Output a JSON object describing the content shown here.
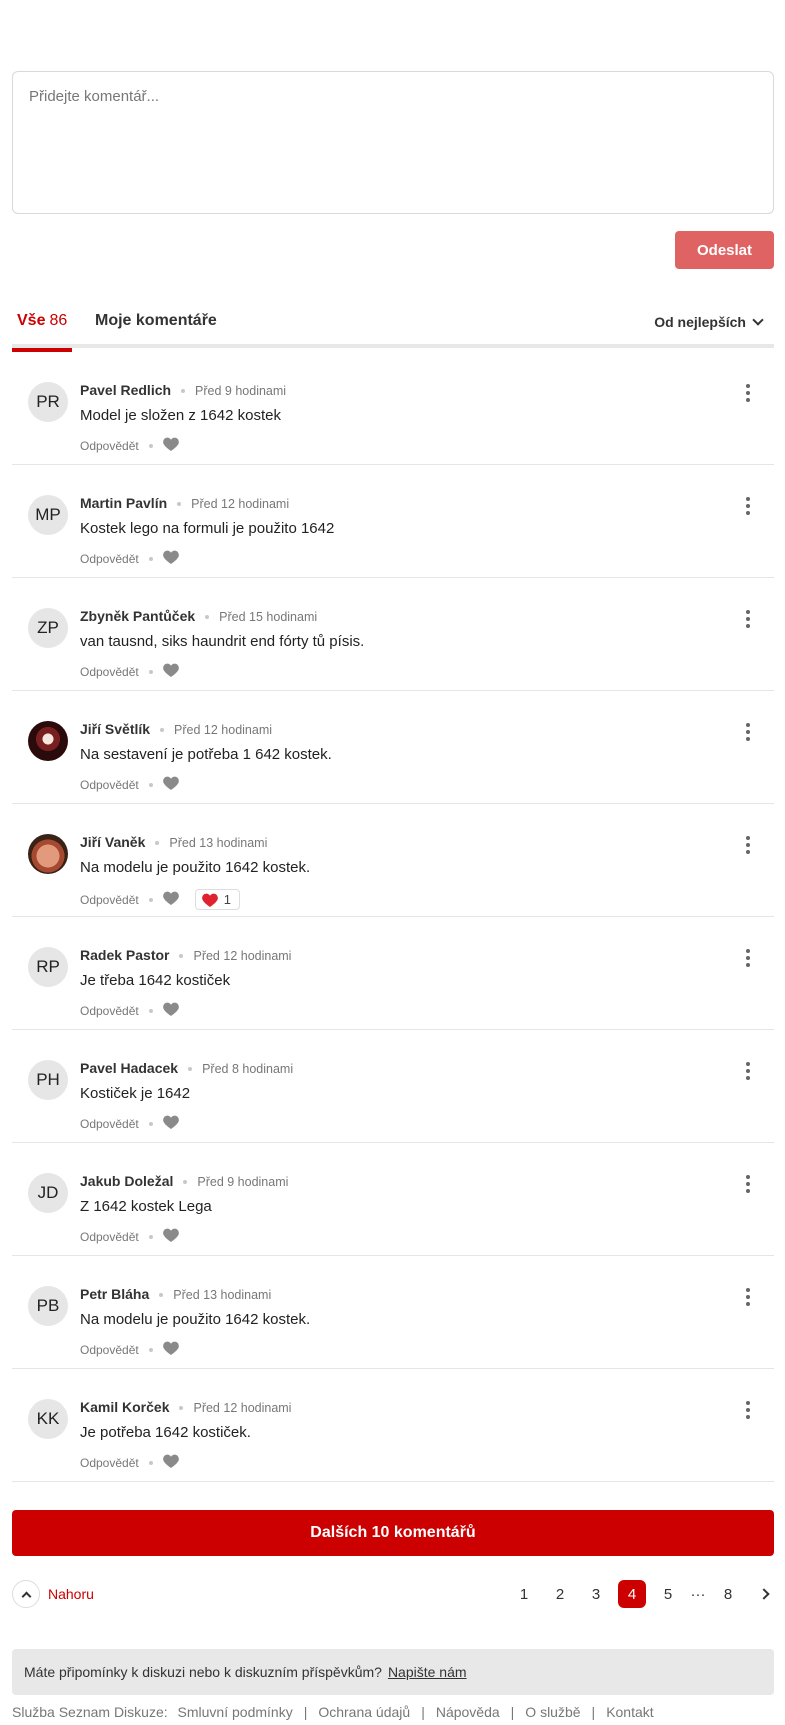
{
  "composer": {
    "placeholder": "Přidejte komentář...",
    "send_label": "Odeslat"
  },
  "tabs": {
    "all_label": "Vše",
    "all_count": "86",
    "mine_label": "Moje komentáře",
    "sort_label": "Od nejlepších"
  },
  "comments": [
    {
      "initials": "PR",
      "author": "Pavel Redlich",
      "time": "Před 9 hodinami",
      "text": "Model je složen z 1642 kostek",
      "reply": "Odpovědět"
    },
    {
      "initials": "MP",
      "author": "Martin Pavlín",
      "time": "Před 12 hodinami",
      "text": "Kostek lego na formuli je použito 1642",
      "reply": "Odpovědět"
    },
    {
      "initials": "ZP",
      "author": "Zbyněk Pantůček",
      "time": "Před 15 hodinami",
      "text": "van tausnd, siks haundrit end fórty tů písis.",
      "reply": "Odpovědět"
    },
    {
      "initials": "",
      "author": "Jiří Světlík",
      "time": "Před 12 hodinami",
      "text": "Na sestavení je potřeba 1 642 kostek.",
      "reply": "Odpovědět"
    },
    {
      "initials": "",
      "author": "Jiří Vaněk",
      "time": "Před 13 hodinami",
      "text": "Na modelu je použito 1642 kostek.",
      "reply": "Odpovědět",
      "likes": "1"
    },
    {
      "initials": "RP",
      "author": "Radek Pastor",
      "time": "Před 12 hodinami",
      "text": "Je třeba 1642 kostiček",
      "reply": "Odpovědět"
    },
    {
      "initials": "PH",
      "author": "Pavel Hadacek",
      "time": "Před 8 hodinami",
      "text": "Kostiček je 1642",
      "reply": "Odpovědět"
    },
    {
      "initials": "JD",
      "author": "Jakub Doležal",
      "time": "Před 9 hodinami",
      "text": "Z 1642 kostek Lega",
      "reply": "Odpovědět"
    },
    {
      "initials": "PB",
      "author": "Petr Bláha",
      "time": "Před 13 hodinami",
      "text": "Na modelu je použito 1642 kostek.",
      "reply": "Odpovědět"
    },
    {
      "initials": "KK",
      "author": "Kamil Korček",
      "time": "Před 12 hodinami",
      "text": "Je potřeba 1642 kostiček.",
      "reply": "Odpovědět"
    }
  ],
  "more_button": "Dalších 10 komentářů",
  "pager": {
    "up_label": "Nahoru",
    "pages": [
      "1",
      "2",
      "3",
      "4",
      "5"
    ],
    "active": "4",
    "ellipsis": "···",
    "last": "8"
  },
  "feedback": {
    "text": "Máte připomínky k diskuzi nebo k diskuzním příspěvkům?",
    "link": "Napište nám"
  },
  "footer": {
    "service": "Služba Seznam Diskuze:",
    "links": [
      "Smluvní podmínky",
      "Ochrana údajů",
      "Nápověda",
      "O službě",
      "Kontakt"
    ]
  },
  "colors": {
    "accent": "#cc0000",
    "send_disabled": "#e06363",
    "like_red": "#e0212f"
  }
}
